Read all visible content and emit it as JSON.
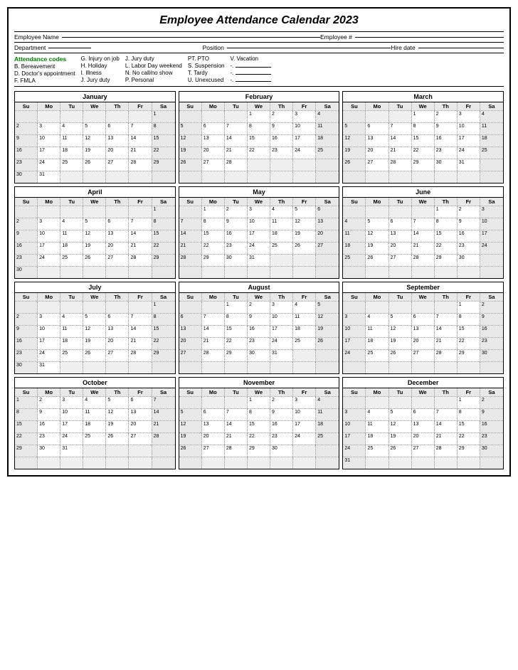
{
  "title": "Employee Attendance Calendar 2023",
  "fields": {
    "employee_name": "Employee Name",
    "employee_number": "Employee #",
    "department": "Department",
    "position": "Position",
    "hire_date": "Hire date"
  },
  "codes": {
    "label": "Attendance codes",
    "col1": [
      "B. Bereavement",
      "D. Doctor's appointment",
      "F. FMLA"
    ],
    "col2": [
      "G. Injury on job",
      "H. Holiday",
      "I. Illness",
      "J. Jury duty"
    ],
    "col3": [
      "J. Jury duty",
      "L. Labor Day weekend",
      "N. No call/no show",
      "P. Personal"
    ],
    "col4": [
      "PT. PTO",
      "S. Suspension",
      "T. Tardy",
      "U. Unexcused"
    ],
    "col5": [
      "V. Vacation",
      "-.",
      "-.",
      "-."
    ]
  },
  "months": [
    {
      "name": "January",
      "weeks": [
        [
          "",
          "",
          "",
          "",
          "",
          "",
          "1"
        ],
        [
          "2",
          "3",
          "4",
          "5",
          "6",
          "7",
          "8"
        ],
        [
          "9",
          "10",
          "11",
          "12",
          "13",
          "14",
          "15"
        ],
        [
          "16",
          "17",
          "18",
          "19",
          "20",
          "21",
          "22"
        ],
        [
          "23",
          "24",
          "25",
          "26",
          "27",
          "28",
          "29"
        ],
        [
          "30",
          "31",
          "",
          "",
          "",
          "",
          ""
        ]
      ]
    },
    {
      "name": "February",
      "weeks": [
        [
          "",
          "",
          "",
          "1",
          "2",
          "3",
          "4"
        ],
        [
          "5",
          "6",
          "7",
          "8",
          "9",
          "10",
          "11"
        ],
        [
          "12",
          "13",
          "14",
          "15",
          "16",
          "17",
          "18"
        ],
        [
          "19",
          "20",
          "21",
          "22",
          "23",
          "24",
          "25"
        ],
        [
          "26",
          "27",
          "28",
          "",
          "",
          "",
          ""
        ],
        [
          "",
          "",
          "",
          "",
          "",
          "",
          ""
        ]
      ]
    },
    {
      "name": "March",
      "weeks": [
        [
          "",
          "",
          "",
          "1",
          "2",
          "3",
          "4"
        ],
        [
          "5",
          "6",
          "7",
          "8",
          "9",
          "10",
          "11"
        ],
        [
          "12",
          "13",
          "14",
          "15",
          "16",
          "17",
          "18"
        ],
        [
          "19",
          "20",
          "21",
          "22",
          "23",
          "24",
          "25"
        ],
        [
          "26",
          "27",
          "28",
          "29",
          "30",
          "31",
          ""
        ],
        [
          "",
          "",
          "",
          "",
          "",
          "",
          ""
        ]
      ]
    },
    {
      "name": "April",
      "weeks": [
        [
          "",
          "",
          "",
          "",
          "",
          "",
          "1"
        ],
        [
          "2",
          "3",
          "4",
          "5",
          "6",
          "7",
          "8"
        ],
        [
          "9",
          "10",
          "11",
          "12",
          "13",
          "14",
          "15"
        ],
        [
          "16",
          "17",
          "18",
          "19",
          "20",
          "21",
          "22"
        ],
        [
          "23",
          "24",
          "25",
          "26",
          "27",
          "28",
          "29"
        ],
        [
          "30",
          "",
          "",
          "",
          "",
          "",
          ""
        ]
      ]
    },
    {
      "name": "May",
      "weeks": [
        [
          "",
          "1",
          "2",
          "3",
          "4",
          "5",
          "6"
        ],
        [
          "7",
          "8",
          "9",
          "10",
          "11",
          "12",
          "13"
        ],
        [
          "14",
          "15",
          "16",
          "17",
          "18",
          "19",
          "20"
        ],
        [
          "21",
          "22",
          "23",
          "24",
          "25",
          "26",
          "27"
        ],
        [
          "28",
          "29",
          "30",
          "31",
          "",
          "",
          ""
        ],
        [
          "",
          "",
          "",
          "",
          "",
          "",
          ""
        ]
      ]
    },
    {
      "name": "June",
      "weeks": [
        [
          "",
          "",
          "",
          "",
          "1",
          "2",
          "3"
        ],
        [
          "4",
          "5",
          "6",
          "7",
          "8",
          "9",
          "10"
        ],
        [
          "11",
          "12",
          "13",
          "14",
          "15",
          "16",
          "17"
        ],
        [
          "18",
          "19",
          "20",
          "21",
          "22",
          "23",
          "24"
        ],
        [
          "25",
          "26",
          "27",
          "28",
          "29",
          "30",
          ""
        ],
        [
          "",
          "",
          "",
          "",
          "",
          "",
          ""
        ]
      ]
    },
    {
      "name": "July",
      "weeks": [
        [
          "",
          "",
          "",
          "",
          "",
          "",
          "1"
        ],
        [
          "2",
          "3",
          "4",
          "5",
          "6",
          "7",
          "8"
        ],
        [
          "9",
          "10",
          "11",
          "12",
          "13",
          "14",
          "15"
        ],
        [
          "16",
          "17",
          "18",
          "19",
          "20",
          "21",
          "22"
        ],
        [
          "23",
          "24",
          "25",
          "26",
          "27",
          "28",
          "29"
        ],
        [
          "30",
          "31",
          "",
          "",
          "",
          "",
          ""
        ]
      ]
    },
    {
      "name": "August",
      "weeks": [
        [
          "",
          "",
          "1",
          "2",
          "3",
          "4",
          "5"
        ],
        [
          "6",
          "7",
          "8",
          "9",
          "10",
          "11",
          "12"
        ],
        [
          "13",
          "14",
          "15",
          "16",
          "17",
          "18",
          "19"
        ],
        [
          "20",
          "21",
          "22",
          "23",
          "24",
          "25",
          "26"
        ],
        [
          "27",
          "28",
          "29",
          "30",
          "31",
          "",
          ""
        ],
        [
          "",
          "",
          "",
          "",
          "",
          "",
          ""
        ]
      ]
    },
    {
      "name": "September",
      "weeks": [
        [
          "",
          "",
          "",
          "",
          "",
          "1",
          "2"
        ],
        [
          "3",
          "4",
          "5",
          "6",
          "7",
          "8",
          "9"
        ],
        [
          "10",
          "11",
          "12",
          "13",
          "14",
          "15",
          "16"
        ],
        [
          "17",
          "18",
          "19",
          "20",
          "21",
          "22",
          "23"
        ],
        [
          "24",
          "25",
          "26",
          "27",
          "28",
          "29",
          "30"
        ],
        [
          "",
          "",
          "",
          "",
          "",
          "",
          ""
        ]
      ]
    },
    {
      "name": "October",
      "weeks": [
        [
          "1",
          "2",
          "3",
          "4",
          "5",
          "6",
          "7"
        ],
        [
          "8",
          "9",
          "10",
          "11",
          "12",
          "13",
          "14"
        ],
        [
          "15",
          "16",
          "17",
          "18",
          "19",
          "20",
          "21"
        ],
        [
          "22",
          "23",
          "24",
          "25",
          "26",
          "27",
          "28"
        ],
        [
          "29",
          "30",
          "31",
          "",
          "",
          "",
          ""
        ],
        [
          "",
          "",
          "",
          "",
          "",
          "",
          ""
        ]
      ]
    },
    {
      "name": "November",
      "weeks": [
        [
          "",
          "",
          "",
          "1",
          "2",
          "3",
          "4"
        ],
        [
          "5",
          "6",
          "7",
          "8",
          "9",
          "10",
          "11"
        ],
        [
          "12",
          "13",
          "14",
          "15",
          "16",
          "17",
          "18"
        ],
        [
          "19",
          "20",
          "21",
          "22",
          "23",
          "24",
          "25"
        ],
        [
          "26",
          "27",
          "28",
          "29",
          "30",
          "",
          ""
        ],
        [
          "",
          "",
          "",
          "",
          "",
          "",
          ""
        ]
      ]
    },
    {
      "name": "December",
      "weeks": [
        [
          "",
          "",
          "",
          "",
          "",
          "1",
          "2"
        ],
        [
          "3",
          "4",
          "5",
          "6",
          "7",
          "8",
          "9"
        ],
        [
          "10",
          "11",
          "12",
          "13",
          "14",
          "15",
          "16"
        ],
        [
          "17",
          "18",
          "19",
          "20",
          "21",
          "22",
          "23"
        ],
        [
          "24",
          "25",
          "26",
          "27",
          "28",
          "29",
          "30"
        ],
        [
          "31",
          "",
          "",
          "",
          "",
          "",
          ""
        ]
      ]
    }
  ],
  "day_headers": [
    "Su",
    "Mo",
    "Tu",
    "We",
    "Th",
    "Fr",
    "Sa"
  ]
}
